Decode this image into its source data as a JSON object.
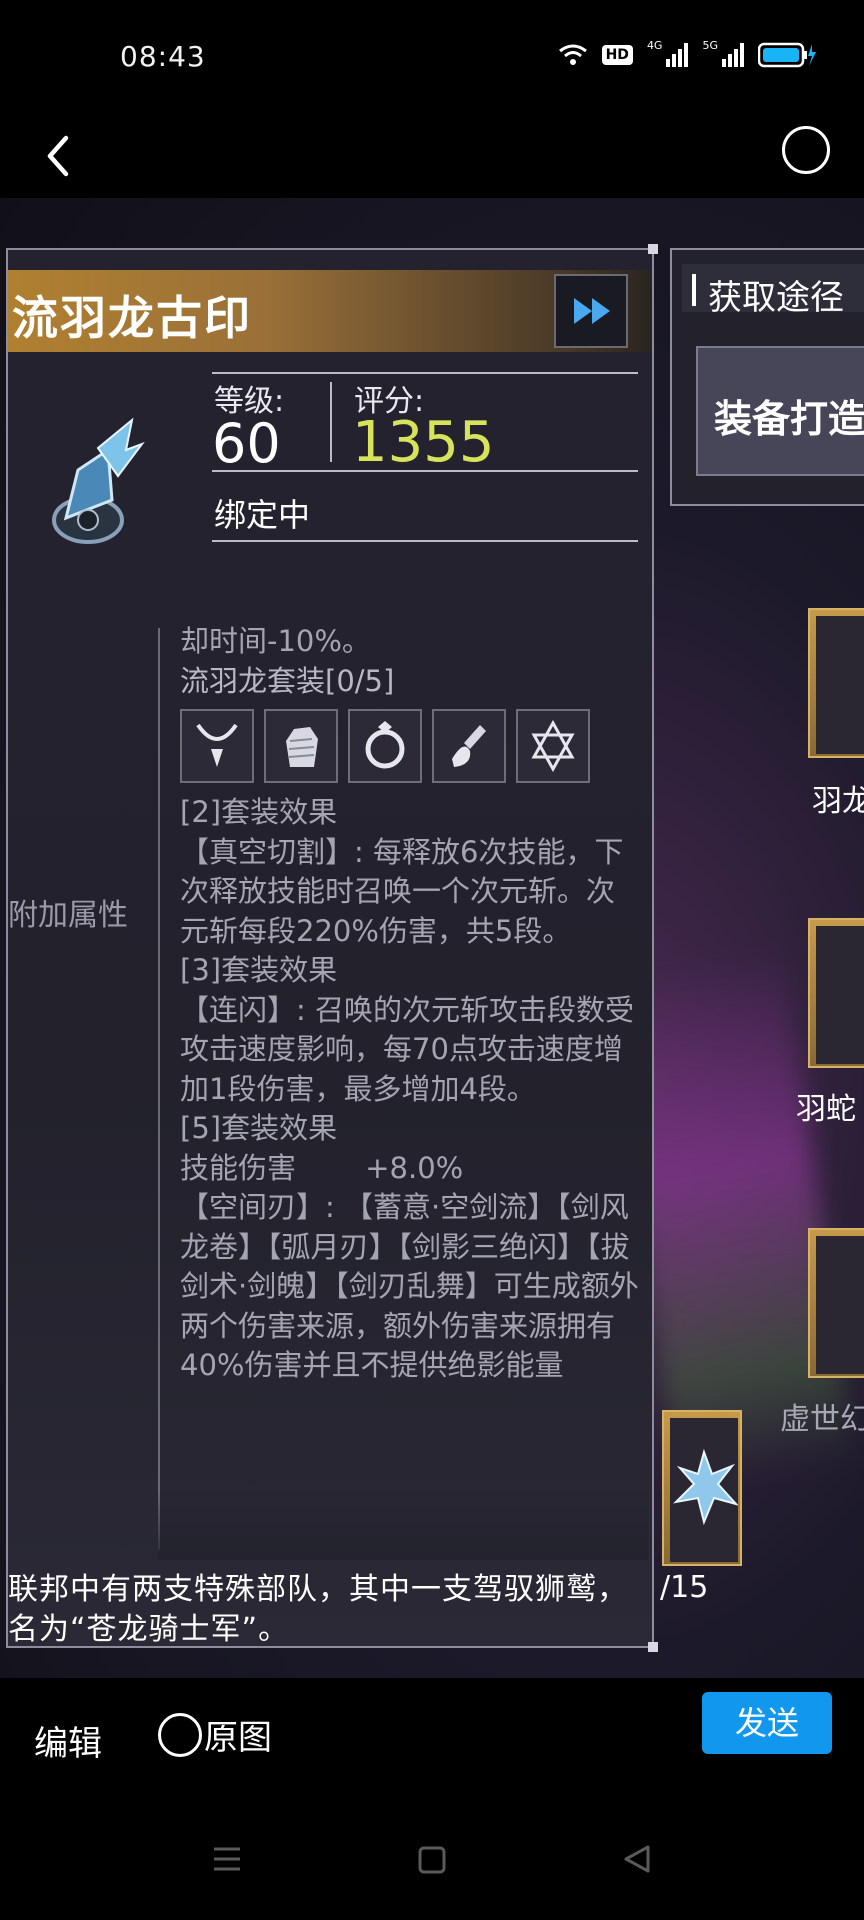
{
  "status_bar": {
    "time": "08:43",
    "hd_label": "HD",
    "network_1": "4G",
    "network_2": "5G"
  },
  "item": {
    "name": "流羽龙古印",
    "level_label": "等级:",
    "level_value": "60",
    "score_label": "评分:",
    "score_value": "1355",
    "bind_status": "绑定中",
    "side_label": "附加属性",
    "description": {
      "line_cooldown": "却时间-10%。",
      "set_name": "流羽龙套装[0/5]",
      "set_icons": [
        "necklace-icon",
        "glove-icon",
        "ring-icon",
        "pendant-icon",
        "hexagram-icon"
      ],
      "effect2_title": "[2]套装效果",
      "effect2_text": "【真空切割】: 每释放6次技能，下次释放技能时召唤一个次元斩。次元斩每段220%伤害，共5段。",
      "effect3_title": "[3]套装效果",
      "effect3_text": "【连闪】: 召唤的次元斩攻击段数受攻击速度影响，每70点攻击速度增加1段伤害，最多增加4段。",
      "effect5_title": "[5]套装效果",
      "effect5_stat_name": "技能伤害",
      "effect5_stat_value": "+8.0%",
      "effect5_text": "【空间刃】: 【蓄意·空剑流】【剑风龙卷】【弧月刃】【剑影三绝闪】【拔剑术·剑魄】【剑刃乱舞】可生成额外两个伤害来源，额外伤害来源拥有40%伤害并且不提供绝影能量"
    },
    "flavor_text": "联邦中有两支特殊部队，其中一支驾驭狮鹫，名为“苍龙骑士军”。"
  },
  "source_panel": {
    "title": "获取途径",
    "craft_label": "装备打造"
  },
  "slots": [
    {
      "label": "羽龙"
    },
    {
      "label": "羽蛇"
    },
    {
      "label": "虚世幻"
    }
  ],
  "slot_count": "/15",
  "bottom_bar": {
    "edit_label": "编辑",
    "original_label": "原图",
    "send_label": "发送"
  },
  "colors": {
    "score": "#d7e35a",
    "send_button": "#1297ef",
    "title_gold": "#b08030"
  }
}
